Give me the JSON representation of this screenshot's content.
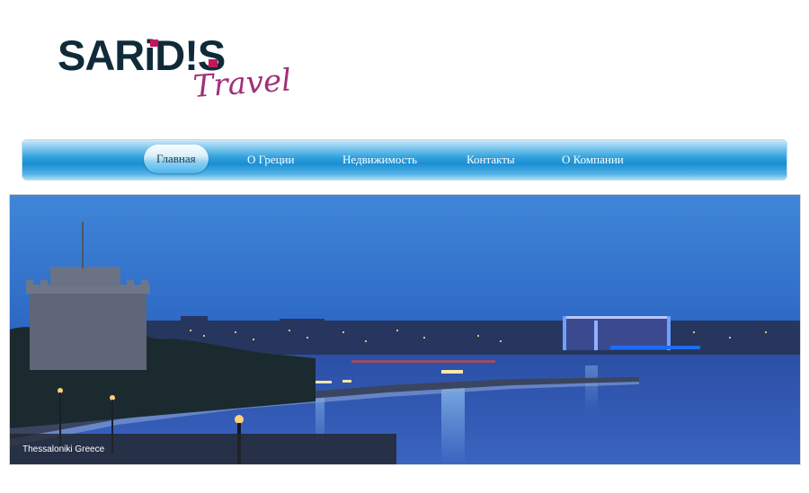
{
  "brand": {
    "name": "SARiD!S",
    "tagline": "Travel",
    "accent_color": "#c2185b",
    "primary_color": "#0f2b3a",
    "tagline_color": "#a0307a"
  },
  "nav": {
    "items": [
      {
        "label": "Главная",
        "active": true
      },
      {
        "label": "О Греции",
        "active": false
      },
      {
        "label": "Недвижимость",
        "active": false
      },
      {
        "label": "Контакты",
        "active": false
      },
      {
        "label": "О Компании",
        "active": false
      }
    ],
    "bar_color": "#1a8fd3"
  },
  "hero": {
    "caption": "Thessaloniki Greece"
  }
}
